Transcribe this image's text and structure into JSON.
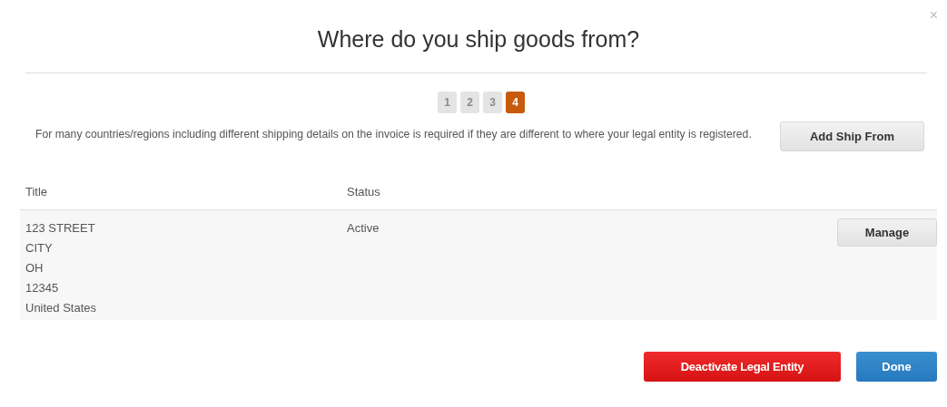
{
  "dialog": {
    "title": "Where do you ship goods from?",
    "close": "×"
  },
  "steps": [
    {
      "label": "1",
      "selected": false
    },
    {
      "label": "2",
      "selected": false
    },
    {
      "label": "3",
      "selected": false
    },
    {
      "label": "4",
      "selected": true
    }
  ],
  "description": "For many countries/regions including different shipping details on the invoice is required if they are different to where your legal entity is registered.",
  "add_button": "Add Ship From",
  "table": {
    "columns": [
      "Title",
      "Status"
    ],
    "rows": [
      {
        "title_lines": [
          "123 STREET",
          "CITY",
          "OH",
          "12345",
          "United States"
        ],
        "status": "Active",
        "action": "Manage"
      }
    ]
  },
  "footer_buttons": [
    {
      "label": "Deactivate Legal Entity",
      "kind": "danger"
    },
    {
      "label": "Done",
      "kind": "primary"
    }
  ]
}
